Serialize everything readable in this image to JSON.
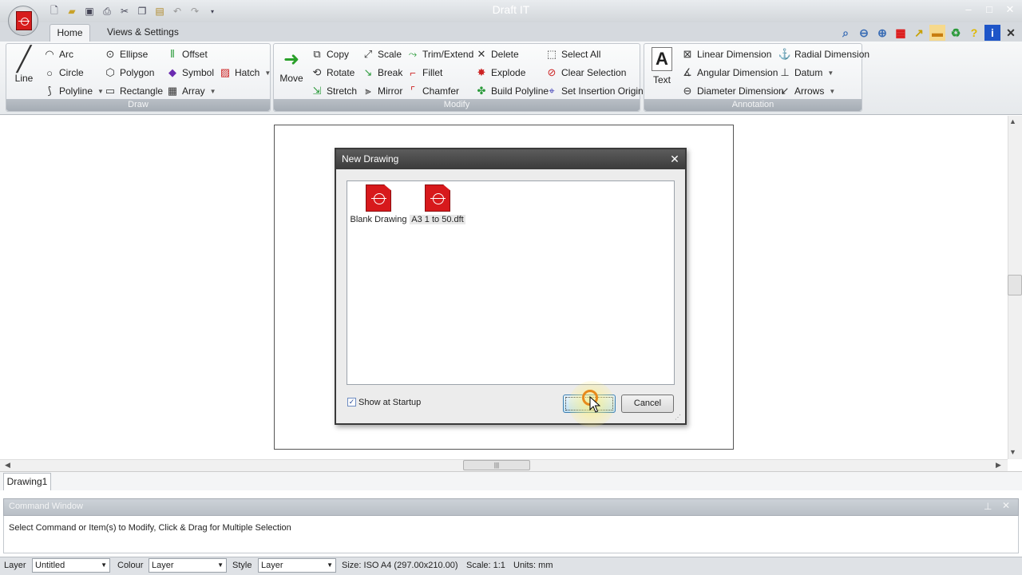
{
  "window": {
    "title": "Draft IT",
    "min": "–",
    "max": "□",
    "close": "✕"
  },
  "qat": [
    "new-icon",
    "open-icon",
    "save-icon",
    "print-icon",
    "cut-icon",
    "copy-icon",
    "paste-icon",
    "undo-icon",
    "redo-icon",
    "customize-icon"
  ],
  "tabs": {
    "home": "Home",
    "views": "Views & Settings"
  },
  "ribbon": {
    "draw": {
      "label": "Draw",
      "line": "Line",
      "arc": "Arc",
      "circle": "Circle",
      "polyline": "Polyline",
      "ellipse": "Ellipse",
      "polygon": "Polygon",
      "rectangle": "Rectangle",
      "offset": "Offset",
      "symbol": "Symbol",
      "hatch": "Hatch",
      "array": "Array"
    },
    "modify": {
      "label": "Modify",
      "move": "Move",
      "copy": "Copy",
      "rotate": "Rotate",
      "stretch": "Stretch",
      "scale": "Scale",
      "break": "Break",
      "mirror": "Mirror",
      "trim": "Trim/Extend",
      "fillet": "Fillet",
      "chamfer": "Chamfer",
      "delete": "Delete",
      "explode": "Explode",
      "build_polyline": "Build Polyline",
      "select_all": "Select All",
      "clear_selection": "Clear Selection",
      "set_insertion": "Set Insertion Origin"
    },
    "annotation": {
      "label": "Annotation",
      "text": "Text",
      "linear": "Linear Dimension",
      "angular": "Angular Dimension",
      "diameter": "Diameter Dimension",
      "radial": "Radial Dimension",
      "datum": "Datum",
      "arrows": "Arrows"
    }
  },
  "dialog": {
    "title": "New Drawing",
    "close": "✕",
    "templates": [
      {
        "label": "Blank Drawing"
      },
      {
        "label": "A3 1 to 50.dft"
      }
    ],
    "show_at_startup": "Show at Startup",
    "show_at_startup_checked": true,
    "ok": "OK",
    "cancel": "Cancel"
  },
  "doc_tab": "Drawing1",
  "command_window": {
    "title": "Command Window",
    "text": "Select Command or Item(s) to Modify, Click & Drag for Multiple Selection"
  },
  "status": {
    "layer_label": "Layer",
    "layer_value": "Untitled",
    "colour_label": "Colour",
    "colour_value": "Layer",
    "style_label": "Style",
    "style_value": "Layer",
    "size": "Size: ISO A4 (297.00x210.00)",
    "scale": "Scale: 1:1",
    "units": "Units: mm"
  },
  "colors": {
    "accent": "#d7191c",
    "ribbon_label": "#a5acb4",
    "dialog_title": "#3b3b3b"
  }
}
